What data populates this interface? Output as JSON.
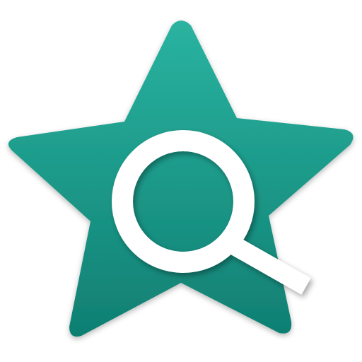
{
  "icon": {
    "name": "star-search-app-icon",
    "star_icon": "star-icon",
    "search_icon": "magnifying-glass-icon",
    "colors": {
      "star_top": "#2ab3a0",
      "star_bottom": "#0f7f72",
      "lens": "#ffffff",
      "background": "#ffffff"
    }
  }
}
